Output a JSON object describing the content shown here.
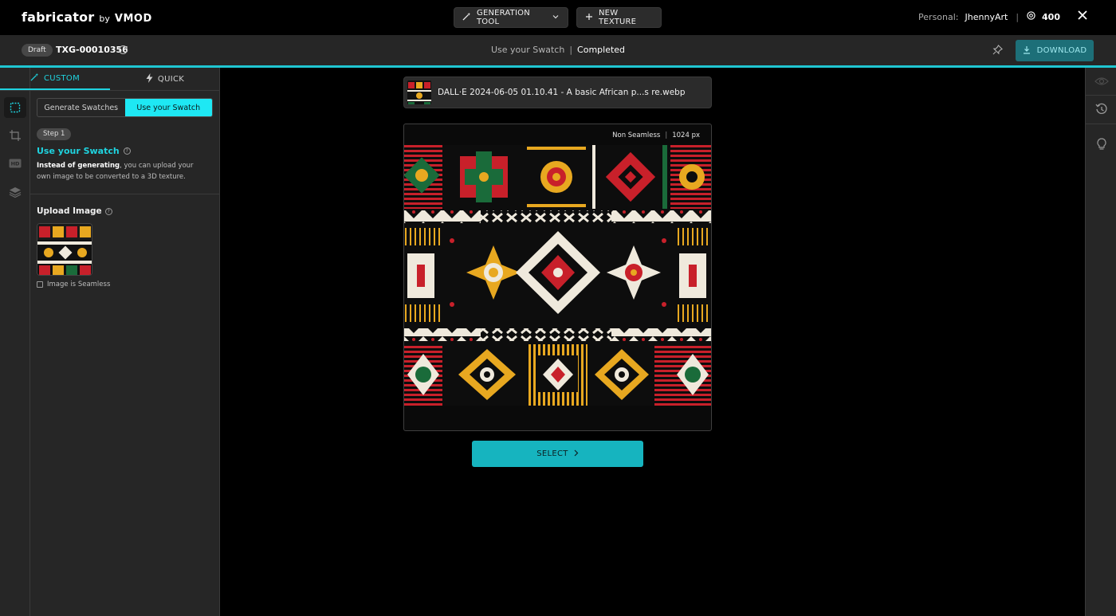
{
  "app": {
    "logo_main": "fabricator",
    "logo_by": "by",
    "logo_mod": "VMOD"
  },
  "topbar": {
    "generation_tool_label": "GENERATION TOOL",
    "new_texture_label": "NEW TEXTURE",
    "personal_label": "Personal:",
    "username": "JhennyArt",
    "separator": "|",
    "credits": "400"
  },
  "subbar": {
    "draft_label": "Draft",
    "texture_id": "TXG-00010356",
    "mode": "Use your Swatch",
    "divider": "|",
    "status": "Completed",
    "download_label": "DOWNLOAD"
  },
  "panel": {
    "tabs": [
      {
        "label": "CUSTOM",
        "icon": "magic-wand-icon",
        "active": true
      },
      {
        "label": "QUICK",
        "icon": "lightning-icon",
        "active": false
      }
    ],
    "segment": [
      {
        "label": "Generate Swatches",
        "active": false
      },
      {
        "label": "Use your Swatch",
        "active": true
      }
    ],
    "step_badge": "Step 1",
    "step_title": "Use your Swatch",
    "desc_bold": "Instead of generating",
    "desc_rest": ", you can upload your own image to be converted to a 3D texture.",
    "upload_title": "Upload Image",
    "seamless_label": "Image is Seamless"
  },
  "main": {
    "file_name": "DALL·E 2024-06-05 01.10.41 - A basic African p...s re.webp",
    "seamless_status": "Non Seamless",
    "meta_sep": "|",
    "resolution": "1024 px",
    "select_label": "SELECT"
  },
  "colors": {
    "accent": "#1fd3df",
    "select_bg": "#16b4bf",
    "download_bg": "#1d6f78",
    "panel_bg": "#262626"
  }
}
